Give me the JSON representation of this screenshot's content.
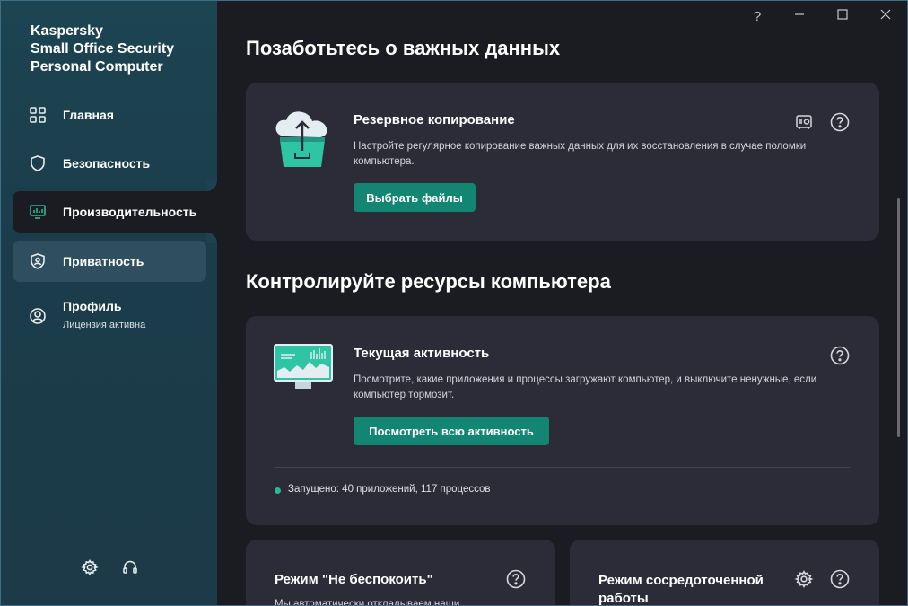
{
  "app": {
    "title_lines": [
      "Kaspersky",
      "Small Office Security",
      "Personal Computer"
    ]
  },
  "window_controls": {
    "help": "?",
    "minimize": "—",
    "maximize": "☐",
    "close": "✕"
  },
  "sidebar": {
    "items": [
      {
        "label": "Главная",
        "icon": "home-grid-icon"
      },
      {
        "label": "Безопасность",
        "icon": "shield-icon"
      },
      {
        "label": "Производительность",
        "icon": "monitor-performance-icon",
        "state": "active"
      },
      {
        "label": "Приватность",
        "icon": "privacy-shield-icon",
        "state": "selected"
      },
      {
        "label": "Профиль",
        "sub": "Лицензия активна",
        "icon": "user-circle-icon"
      }
    ],
    "bottom": [
      "settings-gear-icon",
      "support-headset-icon"
    ]
  },
  "sections": {
    "backup_title": "Позаботьтесь о важных данных",
    "resources_title": "Контролируйте ресурсы компьютера"
  },
  "backup_card": {
    "title": "Резервное копирование",
    "desc": "Настройте регулярное копирование важных данных для их восстановления в случае поломки компьютера.",
    "button": "Выбрать файлы"
  },
  "activity_card": {
    "title": "Текущая активность",
    "desc": "Посмотрите, какие приложения и процессы загружают компьютер, и выключите ненужные, если компьютер тормозит.",
    "button": "Посмотреть всю активность",
    "status": "Запущено: 40 приложений, 117 процессов"
  },
  "dnd_card": {
    "title": "Режим \"Не беспокоить\"",
    "desc": "Мы автоматически откладываем наши"
  },
  "focus_card": {
    "title_lines": [
      "Режим сосредоточенной",
      "работы"
    ]
  },
  "colors": {
    "accent": "#128573",
    "sidebar": "#1c4452",
    "card": "#2c2b38",
    "background": "#1a1c22"
  }
}
